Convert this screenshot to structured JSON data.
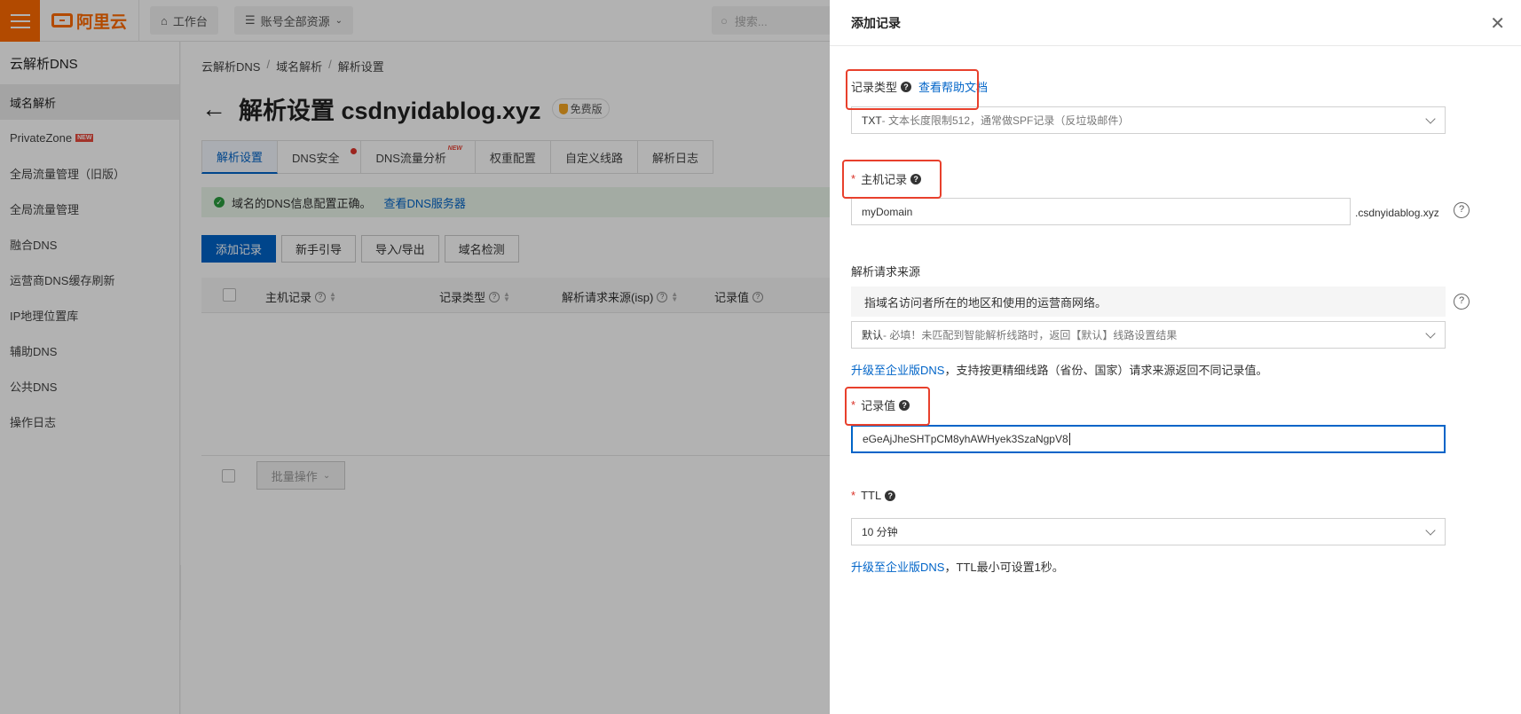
{
  "topbar": {
    "brand": "阿里云",
    "workbench": "工作台",
    "account_scope": "账号全部资源",
    "search_placeholder": "搜索..."
  },
  "sidebar": {
    "title": "云解析DNS",
    "items": [
      {
        "label": "域名解析",
        "active": true
      },
      {
        "label": "PrivateZone",
        "badge": "NEW"
      },
      {
        "label": "全局流量管理（旧版）"
      },
      {
        "label": "全局流量管理"
      },
      {
        "label": "融合DNS"
      },
      {
        "label": "运营商DNS缓存刷新"
      },
      {
        "label": "IP地理位置库"
      },
      {
        "label": "辅助DNS"
      },
      {
        "label": "公共DNS"
      },
      {
        "label": "操作日志"
      }
    ]
  },
  "main": {
    "breadcrumb": [
      "云解析DNS",
      "域名解析",
      "解析设置"
    ],
    "title": "解析设置 csdnyidablog.xyz",
    "badge": "免费版",
    "tabs": [
      "解析设置",
      "DNS安全",
      "DNS流量分析",
      "权重配置",
      "自定义线路",
      "解析日志"
    ],
    "tab_new_tag": "NEW",
    "notice": "域名的DNS信息配置正确。",
    "notice_link": "查看DNS服务器",
    "actions": [
      "添加记录",
      "新手引导",
      "导入/导出",
      "域名检测"
    ],
    "columns": [
      "主机记录",
      "记录类型",
      "解析请求来源(isp)",
      "记录值"
    ],
    "batch": "批量操作"
  },
  "drawer": {
    "title": "添加记录",
    "record_type": {
      "label": "记录类型",
      "help_link": "查看帮助文档",
      "value_main": "TXT",
      "value_desc": "- 文本长度限制512，通常做SPF记录（反垃圾邮件）"
    },
    "host": {
      "label": "主机记录",
      "value": "myDomain",
      "suffix": ".csdnyidablog.xyz"
    },
    "source": {
      "label": "解析请求来源",
      "tip": "指域名访问者所在的地区和使用的运营商网络。",
      "value_main": "默认",
      "value_desc": " - 必填！未匹配到智能解析线路时，返回【默认】线路设置结果",
      "upgrade_link": "升级至企业版DNS",
      "upgrade_text": "，支持按更精细线路（省份、国家）请求来源返回不同记录值。"
    },
    "record_value": {
      "label": "记录值",
      "value": "eGeAjJheSHTpCM8yhAWHyek3SzaNgpV8"
    },
    "ttl": {
      "label": "TTL",
      "value": "10 分钟",
      "upgrade_link": "升级至企业版DNS",
      "upgrade_text": "，TTL最小可设置1秒。"
    }
  },
  "colors": {
    "brand": "#ff6a00",
    "primary": "#0064c8",
    "highlight_box": "#e8402c"
  }
}
